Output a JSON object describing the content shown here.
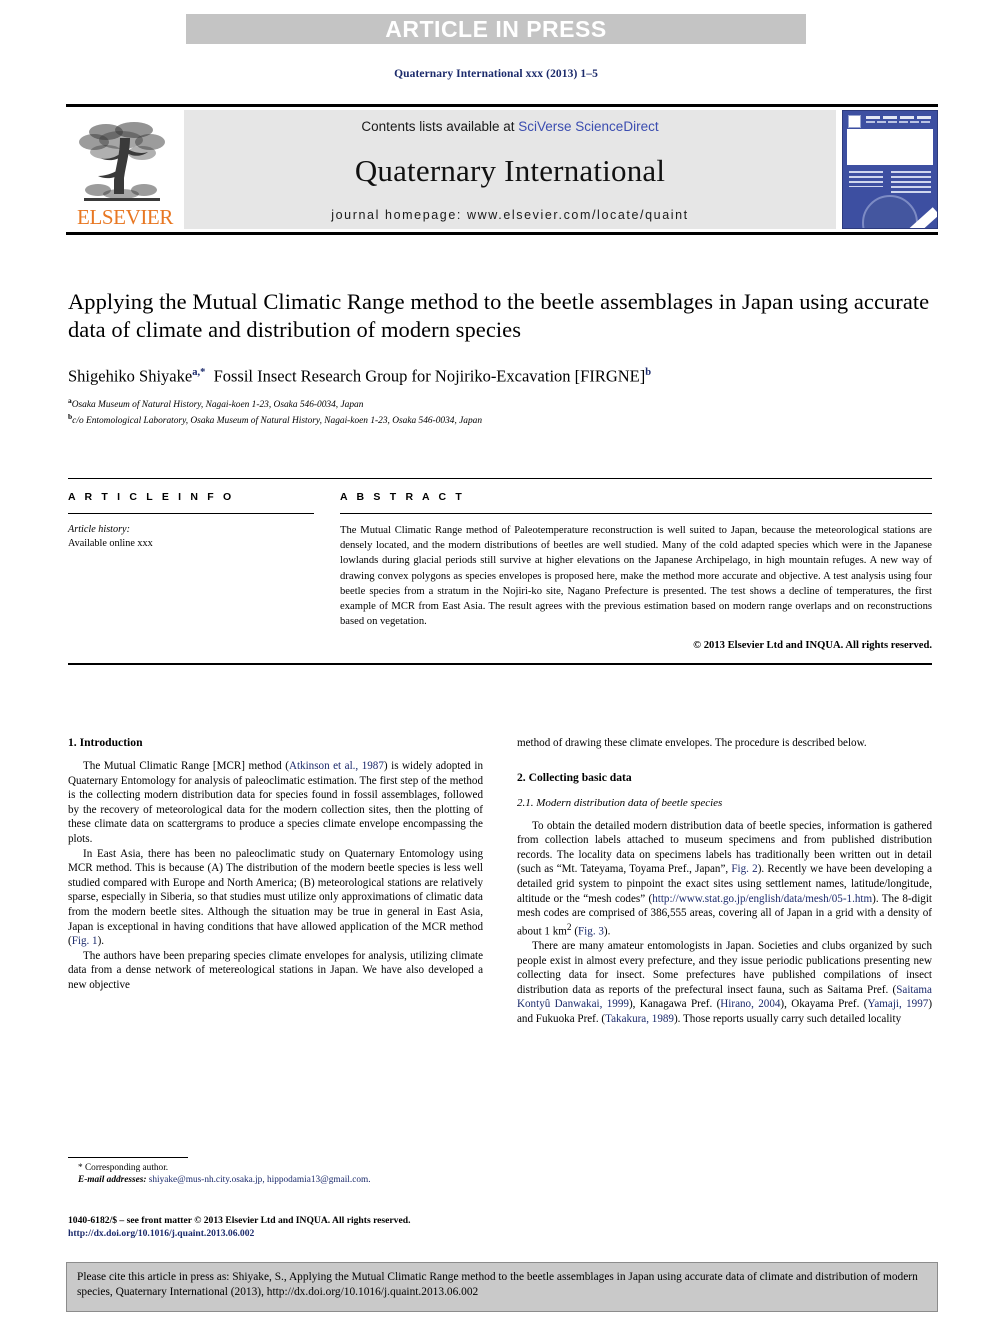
{
  "banner": {
    "text": "ARTICLE IN PRESS"
  },
  "journal_ref": "Quaternary International xxx (2013) 1–5",
  "masthead": {
    "publisher_logo_word": "ELSEVIER",
    "contents_prefix": "Contents lists available at ",
    "contents_link": "SciVerse ScienceDirect",
    "journal_title": "Quaternary International",
    "homepage": "journal homepage: www.elsevier.com/locate/quaint"
  },
  "article": {
    "title": "Applying the Mutual Climatic Range method to the beetle assemblages in Japan using accurate data of climate and distribution of modern species",
    "author1": "Shigehiko Shiyake",
    "author1_marks": "a,*",
    "author2": "Fossil Insect Research Group for Nojiriko-Excavation [FIRGNE]",
    "author2_marks": "b",
    "affiliation_a_mark": "a",
    "affiliation_a": "Osaka Museum of Natural History, Nagai-koen 1-23, Osaka 546-0034, Japan",
    "affiliation_b_mark": "b",
    "affiliation_b": "c/o Entomological Laboratory, Osaka Museum of Natural History, Nagai-koen 1-23, Osaka 546-0034, Japan"
  },
  "article_info": {
    "heading": "A R T I C L E   I N F O",
    "history_label": "Article history:",
    "history_value": "Available online xxx"
  },
  "abstract": {
    "heading": "A B S T R A C T",
    "text": "The Mutual Climatic Range method of Paleotemperature reconstruction is well suited to Japan, because the meteorological stations are densely located, and the modern distributions of beetles are well studied. Many of the cold adapted species which were in the Japanese lowlands during glacial periods still survive at higher elevations on the Japanese Archipelago, in high mountain refuges. A new way of drawing convex polygons as species envelopes is proposed here, make the method more accurate and objective. A test analysis using four beetle species from a stratum in the Nojiri-ko site, Nagano Prefecture is presented. The test shows a decline of temperatures, the first example of MCR from East Asia. The result agrees with the previous estimation based on modern range overlaps and on reconstructions based on vegetation.",
    "copyright": "© 2013 Elsevier Ltd and INQUA. All rights reserved."
  },
  "sections": {
    "intro_heading": "1. Introduction",
    "intro_p1_a": "The Mutual Climatic Range [MCR] method (",
    "intro_p1_ref": "Atkinson et al., 1987",
    "intro_p1_b": ") is widely adopted in Quaternary Entomology for analysis of paleoclimatic estimation. The first step of the method is the collecting modern distribution data for species found in fossil assemblages, followed by the recovery of meteorological data for the modern collection sites, then the plotting of these climate data on scattergrams to produce a species climate envelope encompassing the plots.",
    "intro_p2_a": "In East Asia, there has been no paleoclimatic study on Quaternary Entomology using MCR method. This is because (A) The distribution of the modern beetle species is less well studied compared with Europe and North America; (B) meteorological stations are relatively sparse, especially in Siberia, so that studies must utilize only approximations of climatic data from the modern beetle sites. Although the situation may be true in general in East Asia, Japan is exceptional in having conditions that have allowed application of the MCR method (",
    "intro_p2_ref": "Fig. 1",
    "intro_p2_b": ").",
    "intro_p3": "The authors have been preparing species climate envelopes for analysis, utilizing climate data from a dense network of metereological stations in Japan. We have also developed a new objective",
    "intro_p3_cont": "method of drawing these climate envelopes. The procedure is described below.",
    "collect_heading": "2. Collecting basic data",
    "sub21_heading": "2.1. Modern distribution data of beetle species",
    "p21_a": "To obtain the detailed modern distribution data of beetle species, information is gathered from collection labels attached to museum specimens and from published distribution records. The locality data on specimens labels has traditionally been written out in detail (such as “Mt. Tateyama, Toyama Pref., Japan”, ",
    "p21_fig2": "Fig. 2",
    "p21_b": "). Recently we have been developing a detailed grid system to pinpoint the exact sites using settlement names, latitude/longitude, altitude or the “mesh codes” (",
    "p21_url": "http://www.stat.go.jp/english/data/mesh/05-1.htm",
    "p21_c": "). The 8-digit mesh codes are comprised of 386,555 areas, covering all of Japan in a grid with a density of about 1 km",
    "p21_sup": "2",
    "p21_d": " (",
    "p21_fig3": "Fig. 3",
    "p21_e": ").",
    "p22_a": "There are many amateur entomologists in Japan. Societies and clubs organized by such people exist in almost every prefecture, and they issue periodic publications presenting new collecting data for insect. Some prefectures have published compilations of insect distribution data as reports of the prefectural insect fauna, such as Saitama Pref. (",
    "p22_ref1": "Saitama Kontyû Danwakai, 1999",
    "p22_b": "), Kanagawa Pref. (",
    "p22_ref2": "Hirano, 2004",
    "p22_c": "), Okayama Pref. (",
    "p22_ref3": "Yamaji, 1997",
    "p22_d": ") and Fukuoka Pref. (",
    "p22_ref4": "Takakura, 1989",
    "p22_e": "). Those reports usually carry such detailed locality"
  },
  "footnote": {
    "corresponding": "* Corresponding author.",
    "email_label": "E-mail addresses:",
    "email_value": " shiyake@mus-nh.city.osaka.jp, hippodamia13@gmail.com."
  },
  "issn": {
    "line1": "1040-6182/$ – see front matter © 2013 Elsevier Ltd and INQUA. All rights reserved.",
    "doi": "http://dx.doi.org/10.1016/j.quaint.2013.06.002"
  },
  "cite_box": {
    "text": "Please cite this article in press as: Shiyake, S., Applying the Mutual Climatic Range method to the beetle assemblages in Japan using accurate data of climate and distribution of modern species, Quaternary International (2013), http://dx.doi.org/10.1016/j.quaint.2013.06.002"
  },
  "colors": {
    "banner_bg": "#c4c4c4",
    "link_blue": "#1b2a6b",
    "elsevier_orange": "#e87722",
    "masthead_gray": "#e6e6e6",
    "cite_box_gray": "#c9c9c9"
  }
}
